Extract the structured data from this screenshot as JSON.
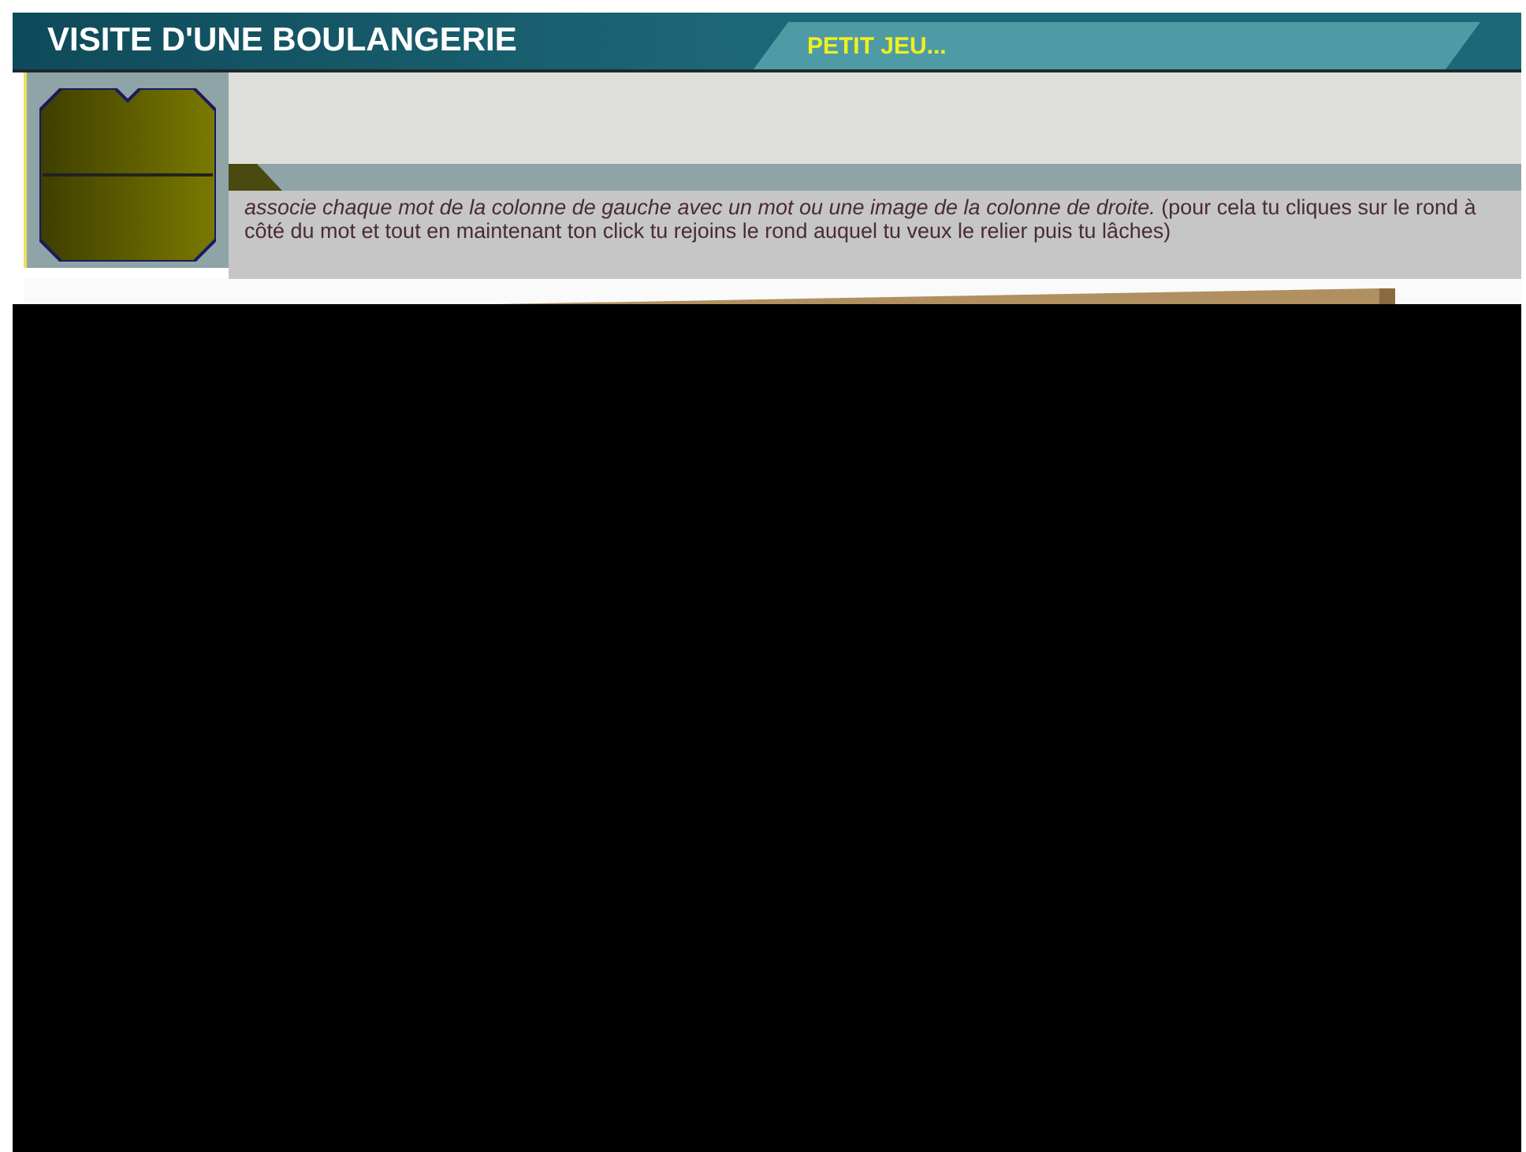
{
  "header": {
    "title": "VISITE D'UNE BOULANGERIE",
    "tab": "PETIT JEU..."
  },
  "instruction": "*associe chaque mot de la colonne de gauche avec un mot ou une image de la colonne de droite.* (pour cela tu cliques sur le rond à côté du mot et tout en maintenant ton click tu rejoins le rond auquel tu veux le relier puis tu lâches)"
}
